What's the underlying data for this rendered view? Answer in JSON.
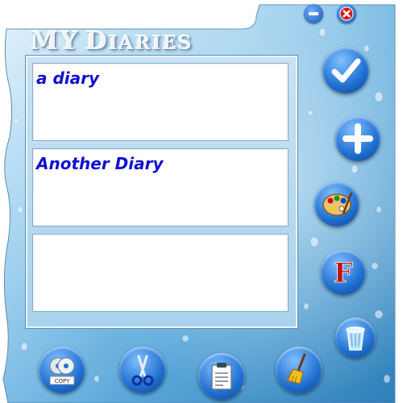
{
  "window": {
    "title_first": "MY",
    "title_big_d": "D",
    "title_rest": "IARIES",
    "minimize_icon": "minimize-icon",
    "close_icon": "close-icon"
  },
  "diaries": [
    {
      "name": "a diary"
    },
    {
      "name": "Another Diary"
    },
    {
      "name": ""
    }
  ],
  "side_buttons": [
    {
      "icon": "checkmark-icon"
    },
    {
      "icon": "plus-icon"
    },
    {
      "icon": "palette-icon"
    },
    {
      "icon": "font-icon",
      "glyph": "F"
    },
    {
      "icon": "trash-icon"
    }
  ],
  "bottom_buttons": [
    {
      "icon": "copy-disc-icon",
      "caption": "COPY"
    },
    {
      "icon": "scissors-icon"
    },
    {
      "icon": "clipboard-icon"
    },
    {
      "icon": "broom-icon"
    }
  ],
  "colors": {
    "water_light": "#d6ecfa",
    "water_dark": "#3f8cc4",
    "button_blue": "#1f6fd0",
    "text_blue": "#1010d0",
    "font_red": "#c41010"
  }
}
